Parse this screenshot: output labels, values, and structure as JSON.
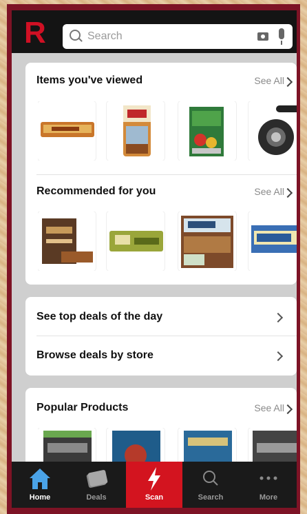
{
  "header": {
    "logo_text": "R",
    "search_placeholder": "Search"
  },
  "viewed": {
    "title": "Items you've viewed",
    "see_all": "See All"
  },
  "recommended": {
    "title": "Recommended for you",
    "see_all": "See All"
  },
  "deals": {
    "top_deals": "See top deals of the day",
    "by_store": "Browse deals by store"
  },
  "popular": {
    "title": "Popular Products",
    "see_all": "See All"
  },
  "tabs": [
    {
      "label": "Home"
    },
    {
      "label": "Deals"
    },
    {
      "label": "Scan"
    },
    {
      "label": "Search"
    },
    {
      "label": "More"
    }
  ],
  "colors": {
    "brand_red": "#d3141f",
    "frame": "#7d1325",
    "tabbar": "#1a1a1a",
    "home_blue": "#4aa3e8"
  }
}
